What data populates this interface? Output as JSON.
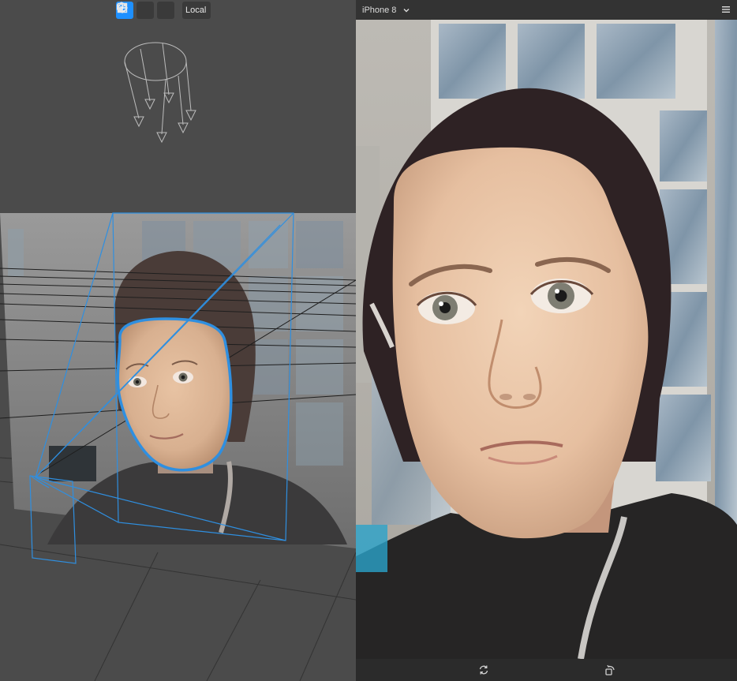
{
  "toolbar": {
    "move_tool": "move-tool",
    "rotate_tool": "rotate-tool",
    "scale_tool": "scale-tool",
    "space_label": "Local",
    "active_tool": "move"
  },
  "preview": {
    "device_label": "iPhone 8"
  },
  "colors": {
    "accent": "#1e90ff",
    "selection_outline": "#2f8fe0"
  },
  "icons": {
    "device_dropdown": "chevron-down-icon",
    "menu": "hamburger-menu-icon",
    "switch_camera": "switch-camera-icon",
    "rotate_device": "rotate-device-icon"
  }
}
